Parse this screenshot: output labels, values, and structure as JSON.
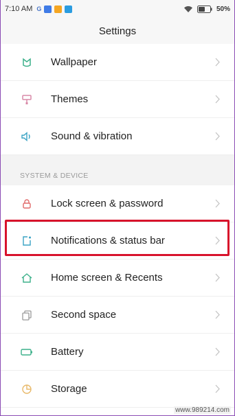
{
  "status_bar": {
    "time": "7:10 AM",
    "notif_letter": "G",
    "battery": "50%",
    "colors": {
      "notif1": "#3f7be6",
      "notif2": "#f5a623",
      "notif3": "#2a9ce0"
    }
  },
  "title": "Settings",
  "section_header": "SYSTEM & DEVICE",
  "items_top": [
    {
      "label": "Wallpaper",
      "icon": "wallpaper-icon"
    },
    {
      "label": "Themes",
      "icon": "themes-icon"
    },
    {
      "label": "Sound & vibration",
      "icon": "sound-icon"
    }
  ],
  "items_device": [
    {
      "label": "Lock screen & password",
      "icon": "lock-icon"
    },
    {
      "label": "Notifications & status bar",
      "icon": "notifications-icon"
    },
    {
      "label": "Home screen & Recents",
      "icon": "home-icon"
    },
    {
      "label": "Second space",
      "icon": "second-space-icon"
    },
    {
      "label": "Battery",
      "icon": "battery-icon"
    },
    {
      "label": "Storage",
      "icon": "storage-icon"
    }
  ],
  "colors": {
    "highlight": "#d8122b",
    "accent_green": "#3cb08a",
    "accent_red": "#e06a6a",
    "accent_blue": "#3aa3c4"
  },
  "watermark": "www.989214.com"
}
